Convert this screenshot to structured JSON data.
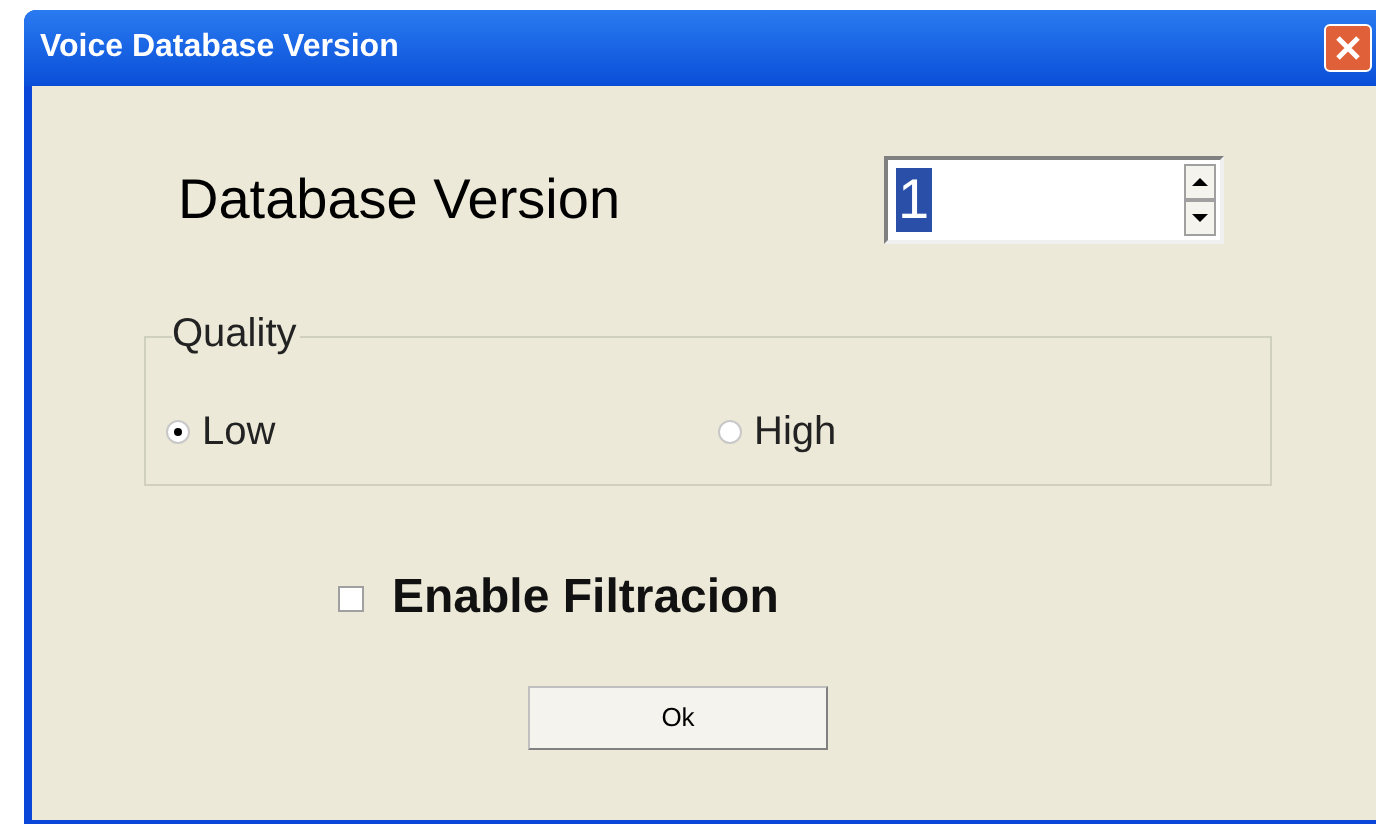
{
  "window": {
    "title": "Voice Database Version"
  },
  "version": {
    "label": "Database Version",
    "value": "1"
  },
  "quality": {
    "title": "Quality",
    "options": [
      {
        "label": "Low",
        "selected": true
      },
      {
        "label": "High",
        "selected": false
      }
    ]
  },
  "filter": {
    "label": "Enable Filtracion",
    "checked": false
  },
  "buttons": [
    "Ok"
  ]
}
